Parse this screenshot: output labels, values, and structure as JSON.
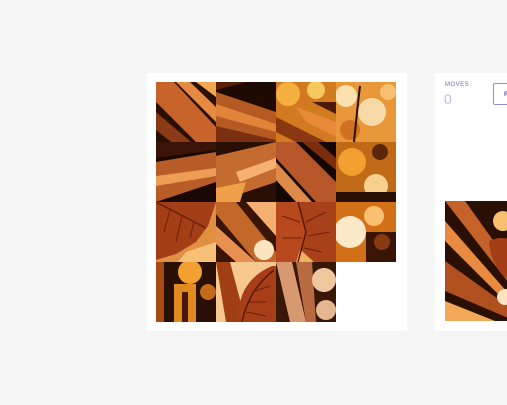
{
  "game": {
    "moves_label": "MOVES",
    "moves_value": "0",
    "reset_label": "R"
  },
  "board": {
    "grid_size": 4,
    "empty_index": 15
  },
  "colors": {
    "background": "#f6f6f6",
    "card": "#ffffff",
    "accent": "#5b5bc8",
    "leaf": "#a8401a",
    "amber": "#f0a030",
    "dark": "#1a0b04"
  }
}
